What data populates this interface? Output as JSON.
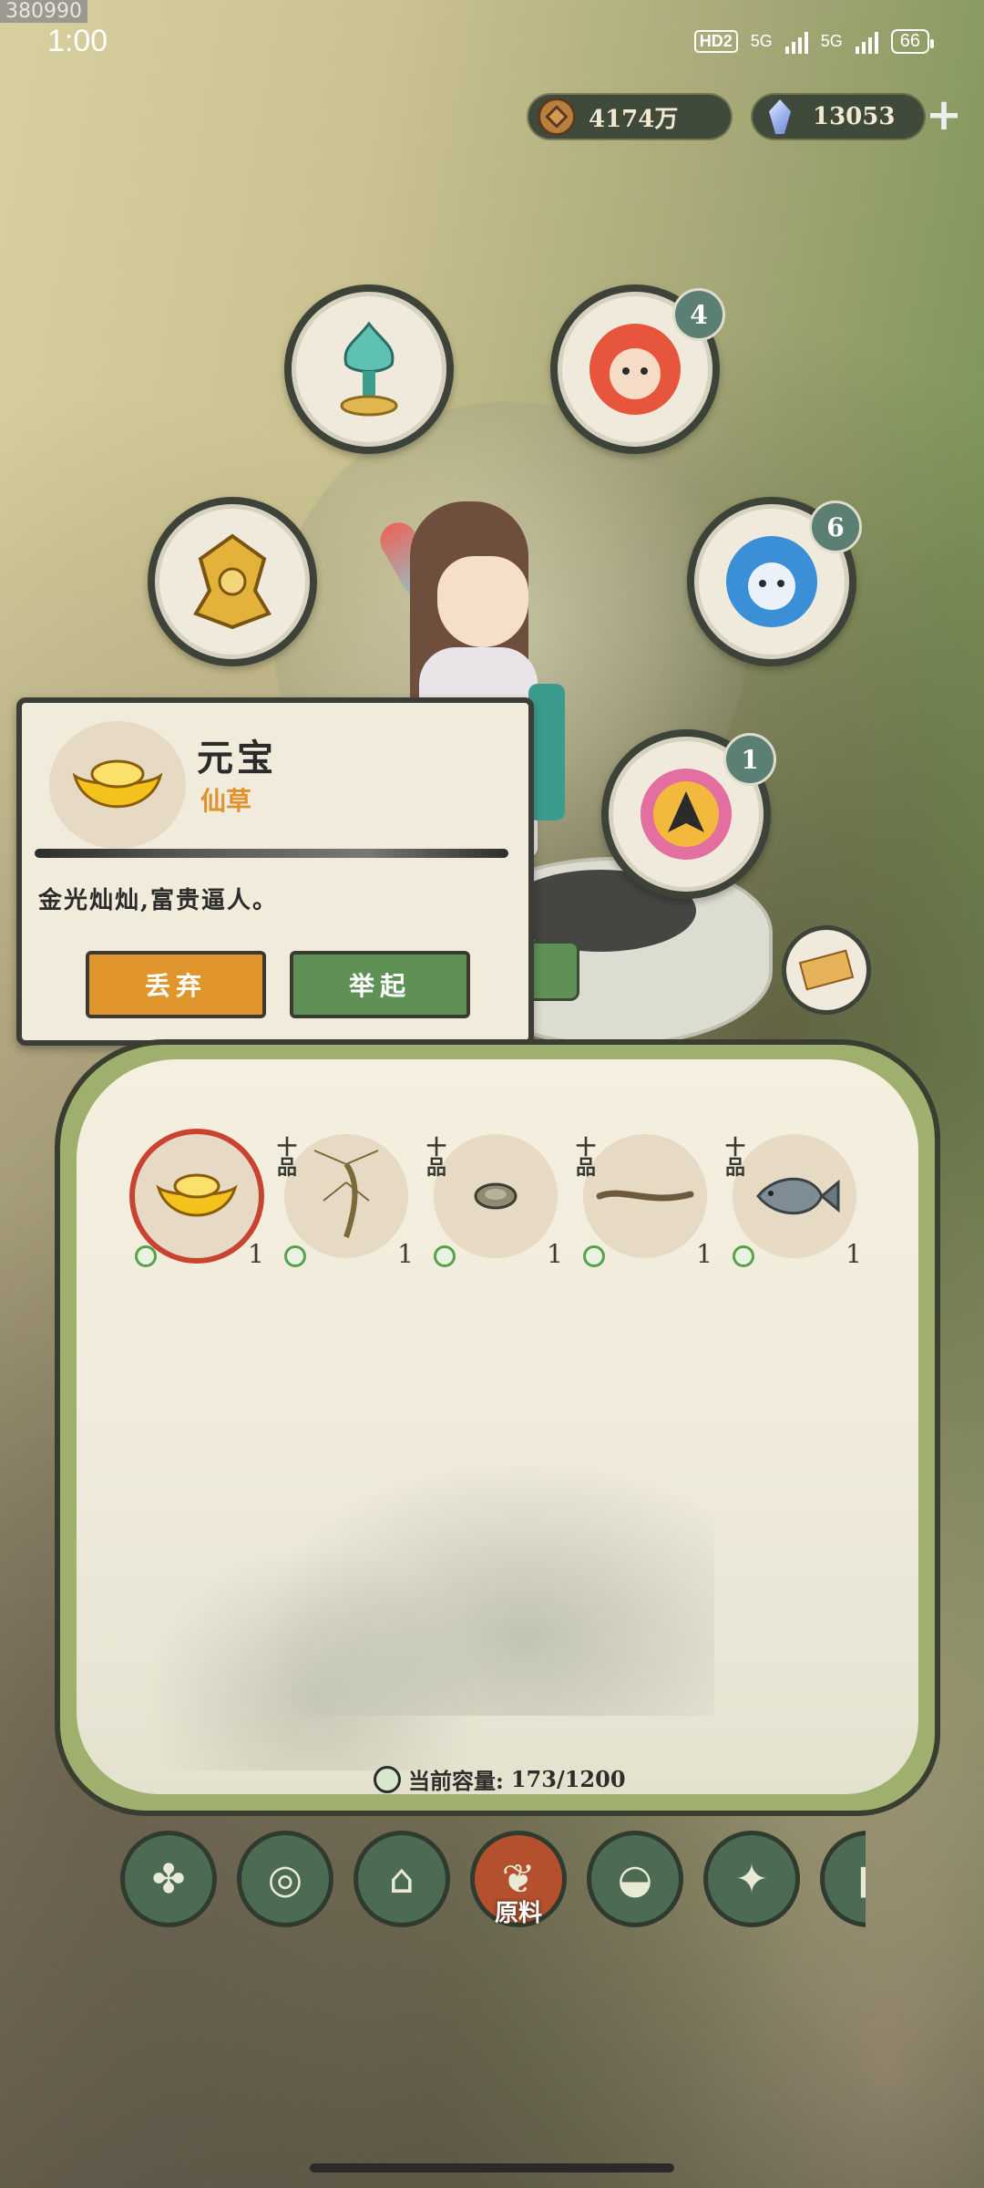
{
  "overlay_id": "380990",
  "status_bar": {
    "time": "1:00",
    "hd": "HD2",
    "net1": "5G",
    "net2": "5G",
    "battery": "66"
  },
  "currency": {
    "coins": "4174万",
    "gems": "13053",
    "add_label": "+"
  },
  "equipment_slots": [
    {
      "icon": "lotus-lamp-icon",
      "badge": null
    },
    {
      "icon": "fire-spirit-icon",
      "badge": "4"
    },
    {
      "icon": "golden-armor-icon",
      "badge": null
    },
    {
      "icon": "water-spirit-icon",
      "badge": "6"
    },
    {
      "icon": "eagle-spirit-icon",
      "badge": "1"
    }
  ],
  "item_popup": {
    "name": "元宝",
    "type": "仙草",
    "description": "金光灿灿,富贵逼人。",
    "discard_label": "丢弃",
    "lift_label": "举起",
    "icon": "gold-ingot-icon"
  },
  "inventory": {
    "items": [
      {
        "icon": "gold-ingot-icon",
        "grade": "",
        "qty": "1",
        "selected": true
      },
      {
        "icon": "shrimp-icon",
        "grade": "十品",
        "qty": "1",
        "selected": false
      },
      {
        "icon": "coin-stone-icon",
        "grade": "十品",
        "qty": "1",
        "selected": false
      },
      {
        "icon": "eel-icon",
        "grade": "十品",
        "qty": "1",
        "selected": false
      },
      {
        "icon": "fish-icon",
        "grade": "十品",
        "qty": "1",
        "selected": false
      }
    ],
    "capacity_label": "当前容量:",
    "capacity_value": "173/1200"
  },
  "nav": [
    {
      "icon": "grid-icon",
      "glyph": "✤",
      "label": "",
      "active": false
    },
    {
      "icon": "wood-log-icon",
      "glyph": "◎",
      "label": "",
      "active": false
    },
    {
      "icon": "house-icon",
      "glyph": "⌂",
      "label": "",
      "active": false
    },
    {
      "icon": "herb-icon",
      "glyph": "❦",
      "label": "原料",
      "active": true
    },
    {
      "icon": "rice-bowl-icon",
      "glyph": "◒",
      "label": "",
      "active": false
    },
    {
      "icon": "scroll-shape-icon",
      "glyph": "✦",
      "label": "",
      "active": false
    },
    {
      "icon": "book-icon",
      "glyph": "▮",
      "label": "",
      "active": false
    }
  ]
}
